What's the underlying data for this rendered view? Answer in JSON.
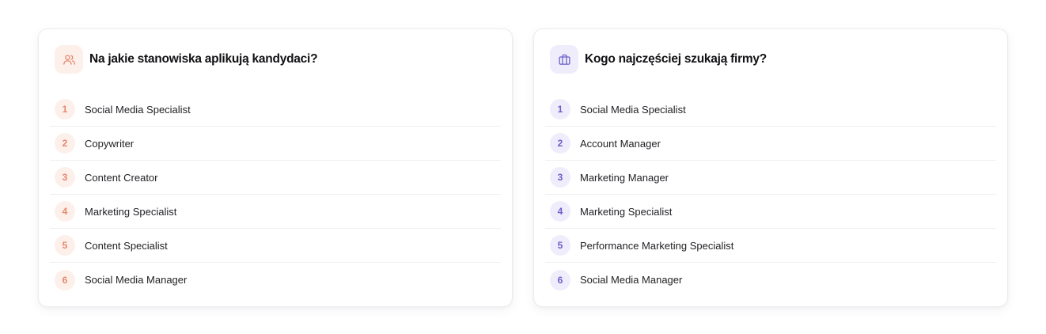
{
  "theme": {
    "left_accent": "#e8866c",
    "left_accent_bg": "#fdf0eb",
    "right_accent": "#6b5fc9",
    "right_accent_bg": "#efedfb"
  },
  "left_card": {
    "title": "Na jakie stanowiska aplikują kandydaci?",
    "icon": "users-icon",
    "items": [
      {
        "rank": "1",
        "label": "Social Media Specialist"
      },
      {
        "rank": "2",
        "label": "Copywriter"
      },
      {
        "rank": "3",
        "label": "Content Creator"
      },
      {
        "rank": "4",
        "label": "Marketing Specialist"
      },
      {
        "rank": "5",
        "label": "Content Specialist"
      },
      {
        "rank": "6",
        "label": "Social Media Manager"
      }
    ]
  },
  "right_card": {
    "title": "Kogo najczęściej szukają firmy?",
    "icon": "briefcase-icon",
    "items": [
      {
        "rank": "1",
        "label": "Social Media Specialist"
      },
      {
        "rank": "2",
        "label": "Account Manager"
      },
      {
        "rank": "3",
        "label": "Marketing Manager"
      },
      {
        "rank": "4",
        "label": "Marketing Specialist"
      },
      {
        "rank": "5",
        "label": "Performance Marketing Specialist"
      },
      {
        "rank": "6",
        "label": "Social Media Manager"
      }
    ]
  }
}
